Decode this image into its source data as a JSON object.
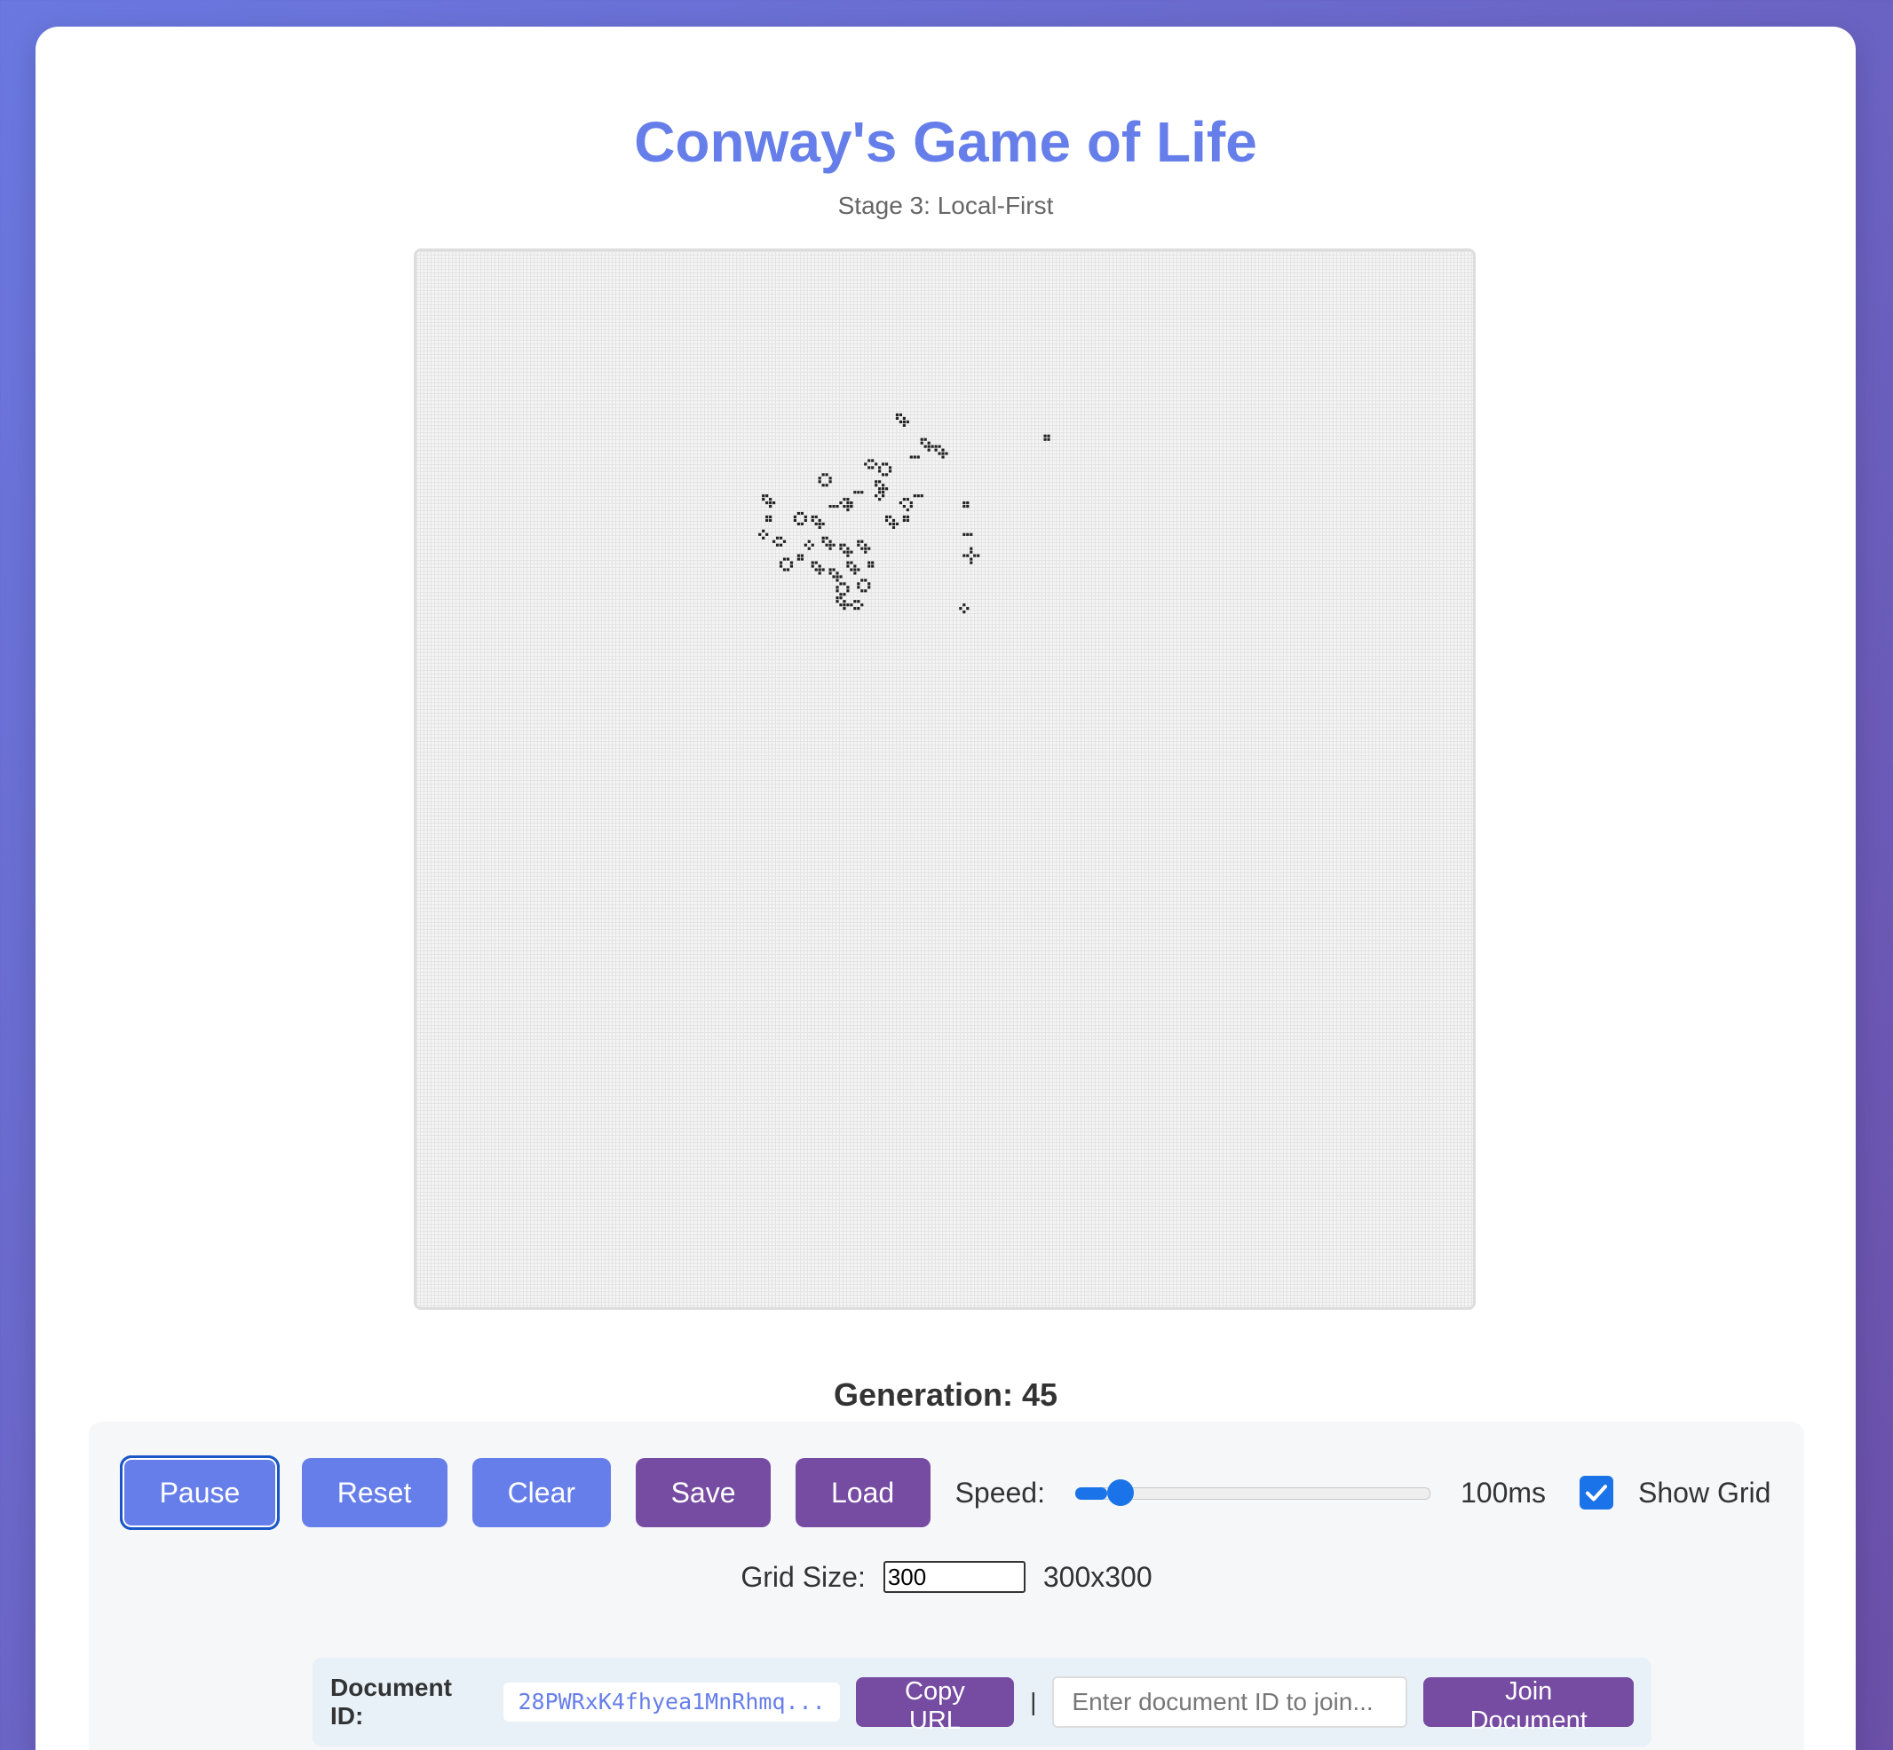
{
  "header": {
    "title": "Conway's Game of Life",
    "subtitle": "Stage 3: Local-First"
  },
  "status": {
    "generation_label": "Generation: 45"
  },
  "board": {
    "grid_size": 300,
    "colors": {
      "cell": "#222222",
      "background": "#f4f4f4",
      "gridline": "#e4e4e4"
    },
    "live_clusters": [
      {
        "col": 136,
        "row": 46,
        "shape": "ship"
      },
      {
        "col": 143,
        "row": 53,
        "shape": "ship"
      },
      {
        "col": 147,
        "row": 55,
        "shape": "ship"
      },
      {
        "col": 178,
        "row": 52,
        "shape": "block"
      },
      {
        "col": 131,
        "row": 60,
        "shape": "pond"
      },
      {
        "col": 127,
        "row": 59,
        "shape": "beehive"
      },
      {
        "col": 130,
        "row": 65,
        "shape": "ship"
      },
      {
        "col": 140,
        "row": 58,
        "shape": "blinker"
      },
      {
        "col": 114,
        "row": 63,
        "shape": "pond"
      },
      {
        "col": 120,
        "row": 70,
        "shape": "loaf"
      },
      {
        "col": 124,
        "row": 68,
        "shape": "blinker"
      },
      {
        "col": 130,
        "row": 68,
        "shape": "tub"
      },
      {
        "col": 137,
        "row": 70,
        "shape": "loaf"
      },
      {
        "col": 141,
        "row": 69,
        "shape": "blinker"
      },
      {
        "col": 98,
        "row": 69,
        "shape": "ship"
      },
      {
        "col": 99,
        "row": 75,
        "shape": "block"
      },
      {
        "col": 107,
        "row": 74,
        "shape": "pond"
      },
      {
        "col": 112,
        "row": 75,
        "shape": "ship"
      },
      {
        "col": 117,
        "row": 72,
        "shape": "blinker"
      },
      {
        "col": 122,
        "row": 71,
        "shape": "block"
      },
      {
        "col": 133,
        "row": 75,
        "shape": "ship"
      },
      {
        "col": 138,
        "row": 75,
        "shape": "block"
      },
      {
        "col": 97,
        "row": 79,
        "shape": "tub"
      },
      {
        "col": 101,
        "row": 81,
        "shape": "beehive"
      },
      {
        "col": 110,
        "row": 82,
        "shape": "tub"
      },
      {
        "col": 115,
        "row": 81,
        "shape": "ship"
      },
      {
        "col": 120,
        "row": 83,
        "shape": "ship"
      },
      {
        "col": 125,
        "row": 82,
        "shape": "ship"
      },
      {
        "col": 155,
        "row": 71,
        "shape": "block"
      },
      {
        "col": 155,
        "row": 80,
        "shape": "blinker"
      },
      {
        "col": 155,
        "row": 84,
        "shape": "cross"
      },
      {
        "col": 103,
        "row": 87,
        "shape": "pond"
      },
      {
        "col": 108,
        "row": 86,
        "shape": "block"
      },
      {
        "col": 112,
        "row": 88,
        "shape": "ship"
      },
      {
        "col": 117,
        "row": 90,
        "shape": "ship"
      },
      {
        "col": 122,
        "row": 88,
        "shape": "ship"
      },
      {
        "col": 128,
        "row": 88,
        "shape": "block"
      },
      {
        "col": 119,
        "row": 94,
        "shape": "pond"
      },
      {
        "col": 125,
        "row": 93,
        "shape": "pond"
      },
      {
        "col": 119,
        "row": 98,
        "shape": "ship"
      },
      {
        "col": 123,
        "row": 99,
        "shape": "beehive"
      },
      {
        "col": 154,
        "row": 100,
        "shape": "tub"
      }
    ]
  },
  "controls": {
    "pause_label": "Pause",
    "reset_label": "Reset",
    "clear_label": "Clear",
    "save_label": "Save",
    "load_label": "Load",
    "speed_label": "Speed:",
    "speed_value": "100ms",
    "speed_fraction": 0.09,
    "show_grid_label": "Show Grid",
    "show_grid_checked": true,
    "grid_size_label": "Grid Size:",
    "grid_size_value": "300",
    "grid_dims": "300x300"
  },
  "document": {
    "label": "Document ID:",
    "id_display": "28PWRxK4fhyea1MnRhmq...",
    "copy_url_label": "Copy URL",
    "separator": "|",
    "join_placeholder": "Enter document ID to join...",
    "join_label": "Join Document"
  },
  "colors": {
    "accent_blue": "#667eea",
    "accent_purple": "#764ba2",
    "checkbox_blue": "#1a73e8"
  }
}
